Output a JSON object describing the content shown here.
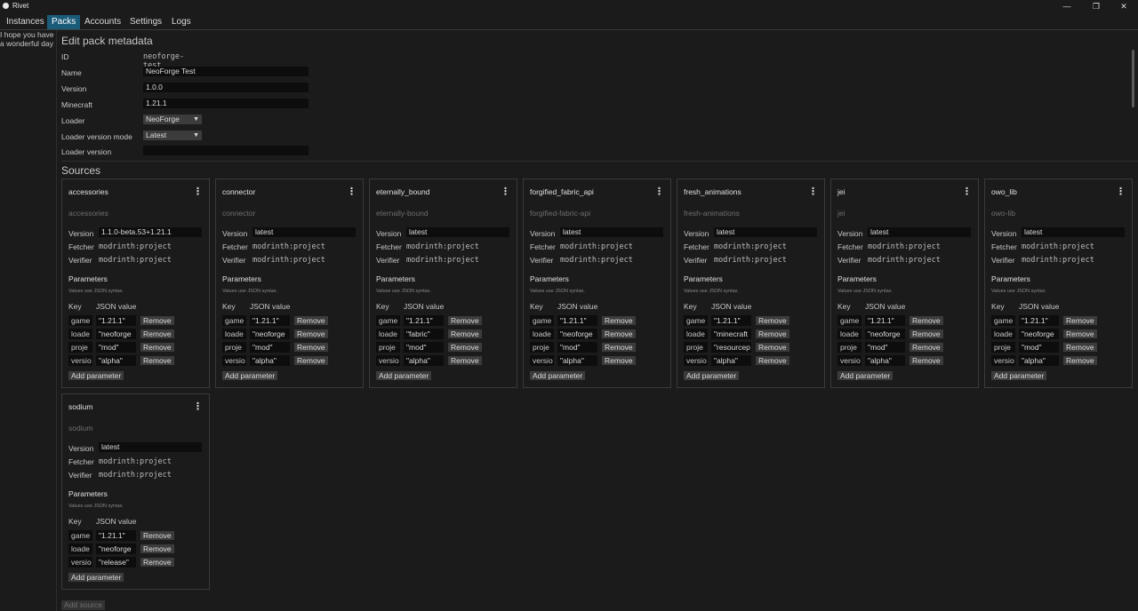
{
  "window": {
    "title": "Rivet",
    "min_glyph": "—",
    "max_glyph": "❐",
    "close_glyph": "✕"
  },
  "menu": {
    "items": [
      "Instances",
      "Packs",
      "Accounts",
      "Settings",
      "Logs"
    ],
    "active": "Packs"
  },
  "sidebar": {
    "greeting_line1": "I hope you have",
    "greeting_line2": "a wonderful day"
  },
  "edit": {
    "heading": "Edit pack metadata",
    "id_label": "ID",
    "id_value": "neoforge-test",
    "name_label": "Name",
    "name_value": "NeoForge Test",
    "version_label": "Version",
    "version_value": "1.0.0",
    "minecraft_label": "Minecraft",
    "minecraft_value": "1.21.1",
    "loader_label": "Loader",
    "loader_value": "NeoForge",
    "loader_mode_label": "Loader version mode",
    "loader_mode_value": "Latest",
    "loader_version_label": "Loader version",
    "loader_version_value": ""
  },
  "sources_heading": "Sources",
  "card_labels": {
    "version": "Version",
    "fetcher": "Fetcher",
    "verifier": "Verifier",
    "parameters": "Parameters",
    "hint": "Values use JSON syntax.",
    "key": "Key",
    "json_value": "JSON value",
    "remove": "Remove",
    "add_parameter": "Add parameter",
    "menu_glyph": "⋮"
  },
  "sources": [
    {
      "title": "accessories",
      "slug": "accessories",
      "version": "1.1.0-beta.53+1.21.1",
      "fetcher": "modrinth:project",
      "verifier": "modrinth:project",
      "params": [
        {
          "key": "game",
          "value": "\"1.21.1\""
        },
        {
          "key": "loade",
          "value": "\"neoforge"
        },
        {
          "key": "proje",
          "value": "\"mod\""
        },
        {
          "key": "versio",
          "value": "\"alpha\""
        }
      ]
    },
    {
      "title": "connector",
      "slug": "connector",
      "version": "latest",
      "fetcher": "modrinth:project",
      "verifier": "modrinth:project",
      "params": [
        {
          "key": "game",
          "value": "\"1.21.1\""
        },
        {
          "key": "loade",
          "value": "\"neoforge"
        },
        {
          "key": "proje",
          "value": "\"mod\""
        },
        {
          "key": "versio",
          "value": "\"alpha\""
        }
      ]
    },
    {
      "title": "eternally_bound",
      "slug": "eternally-bound",
      "version": "latest",
      "fetcher": "modrinth:project",
      "verifier": "modrinth:project",
      "params": [
        {
          "key": "game",
          "value": "\"1.21.1\""
        },
        {
          "key": "loade",
          "value": "\"fabric\""
        },
        {
          "key": "proje",
          "value": "\"mod\""
        },
        {
          "key": "versio",
          "value": "\"alpha\""
        }
      ]
    },
    {
      "title": "forgified_fabric_api",
      "slug": "forgified-fabric-api",
      "version": "latest",
      "fetcher": "modrinth:project",
      "verifier": "modrinth:project",
      "params": [
        {
          "key": "game",
          "value": "\"1.21.1\""
        },
        {
          "key": "loade",
          "value": "\"neoforge"
        },
        {
          "key": "proje",
          "value": "\"mod\""
        },
        {
          "key": "versio",
          "value": "\"alpha\""
        }
      ]
    },
    {
      "title": "fresh_animations",
      "slug": "fresh-animations",
      "version": "latest",
      "fetcher": "modrinth:project",
      "verifier": "modrinth:project",
      "params": [
        {
          "key": "game",
          "value": "\"1.21.1\""
        },
        {
          "key": "loade",
          "value": "\"minecraft"
        },
        {
          "key": "proje",
          "value": "\"resourcep"
        },
        {
          "key": "versio",
          "value": "\"alpha\""
        }
      ]
    },
    {
      "title": "jei",
      "slug": "jei",
      "version": "latest",
      "fetcher": "modrinth:project",
      "verifier": "modrinth:project",
      "params": [
        {
          "key": "game",
          "value": "\"1.21.1\""
        },
        {
          "key": "loade",
          "value": "\"neoforge"
        },
        {
          "key": "proje",
          "value": "\"mod\""
        },
        {
          "key": "versio",
          "value": "\"alpha\""
        }
      ]
    },
    {
      "title": "owo_lib",
      "slug": "owo-lib",
      "version": "latest",
      "fetcher": "modrinth:project",
      "verifier": "modrinth:project",
      "params": [
        {
          "key": "game",
          "value": "\"1.21.1\""
        },
        {
          "key": "loade",
          "value": "\"neoforge"
        },
        {
          "key": "proje",
          "value": "\"mod\""
        },
        {
          "key": "versio",
          "value": "\"alpha\""
        }
      ]
    },
    {
      "title": "sodium",
      "slug": "sodium",
      "version": "latest",
      "fetcher": "modrinth:project",
      "verifier": "modrinth:project",
      "params": [
        {
          "key": "game",
          "value": "\"1.21.1\""
        },
        {
          "key": "loade",
          "value": "\"neoforge"
        },
        {
          "key": "versio",
          "value": "\"release\""
        }
      ]
    }
  ],
  "add_source": "Add source"
}
